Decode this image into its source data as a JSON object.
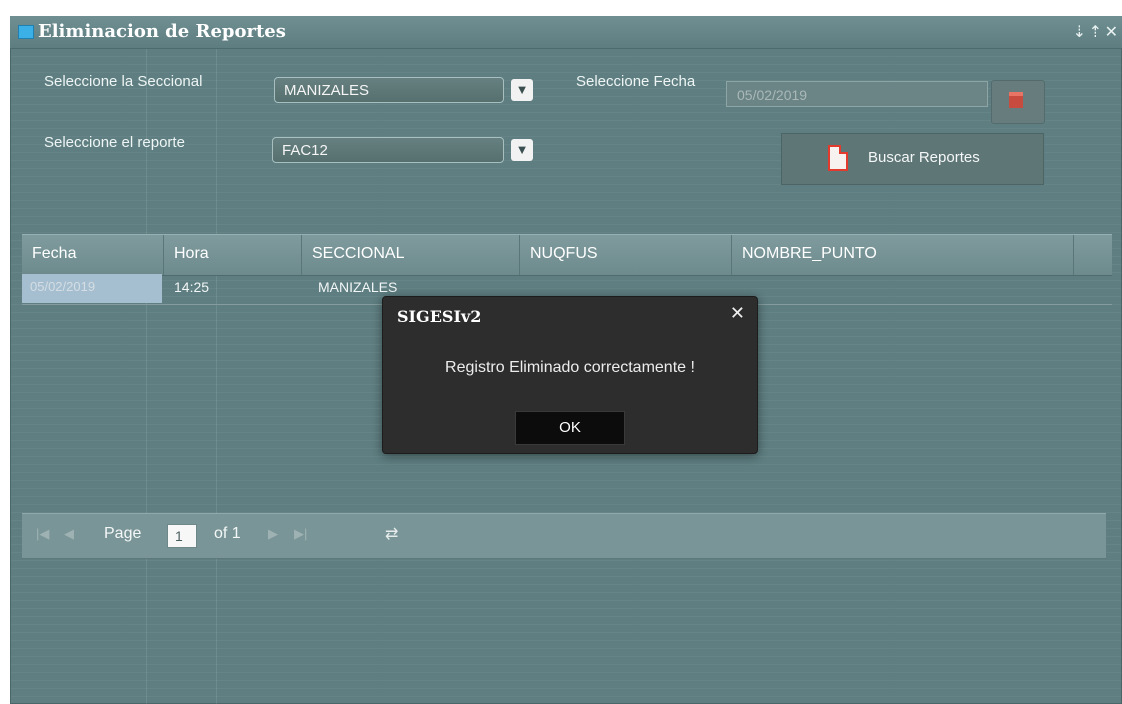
{
  "window": {
    "title": "Eliminacion de Reportes",
    "controls": {
      "pin": "⇣",
      "restore": "⇡",
      "close": "✕"
    }
  },
  "form": {
    "seccional_label": "Seleccione la Seccional",
    "seccional_value": "MANIZALES",
    "reporte_label": "Seleccione el reporte",
    "reporte_value": "FAC12",
    "fecha_label": "Seleccione Fecha",
    "fecha_value": "05/02/2019",
    "dropdown_icon": "chevron-down-icon",
    "search_button_label": "Buscar Reportes"
  },
  "grid": {
    "columns": [
      "Fecha",
      "Hora",
      "SECCIONAL",
      "NUQFUS",
      "NOMBRE_PUNTO"
    ],
    "rows": [
      {
        "fecha": "05/02/2019",
        "hora": "14:25",
        "seccional": "MANIZALES",
        "nuqfus": "",
        "nombre_punto": ""
      }
    ]
  },
  "pager": {
    "page_label": "Page",
    "current_page": "1",
    "of_label": "of 1"
  },
  "modal": {
    "title": "SIGESIv2",
    "message": "Registro Eliminado correctamente !",
    "ok_label": "OK",
    "close_label": "✕"
  },
  "colors": {
    "window_bg": "#5e7e81",
    "modal_bg": "#2d2d2d",
    "pdf_red": "#e23a2c",
    "selected_row": "#a6bfd0"
  }
}
